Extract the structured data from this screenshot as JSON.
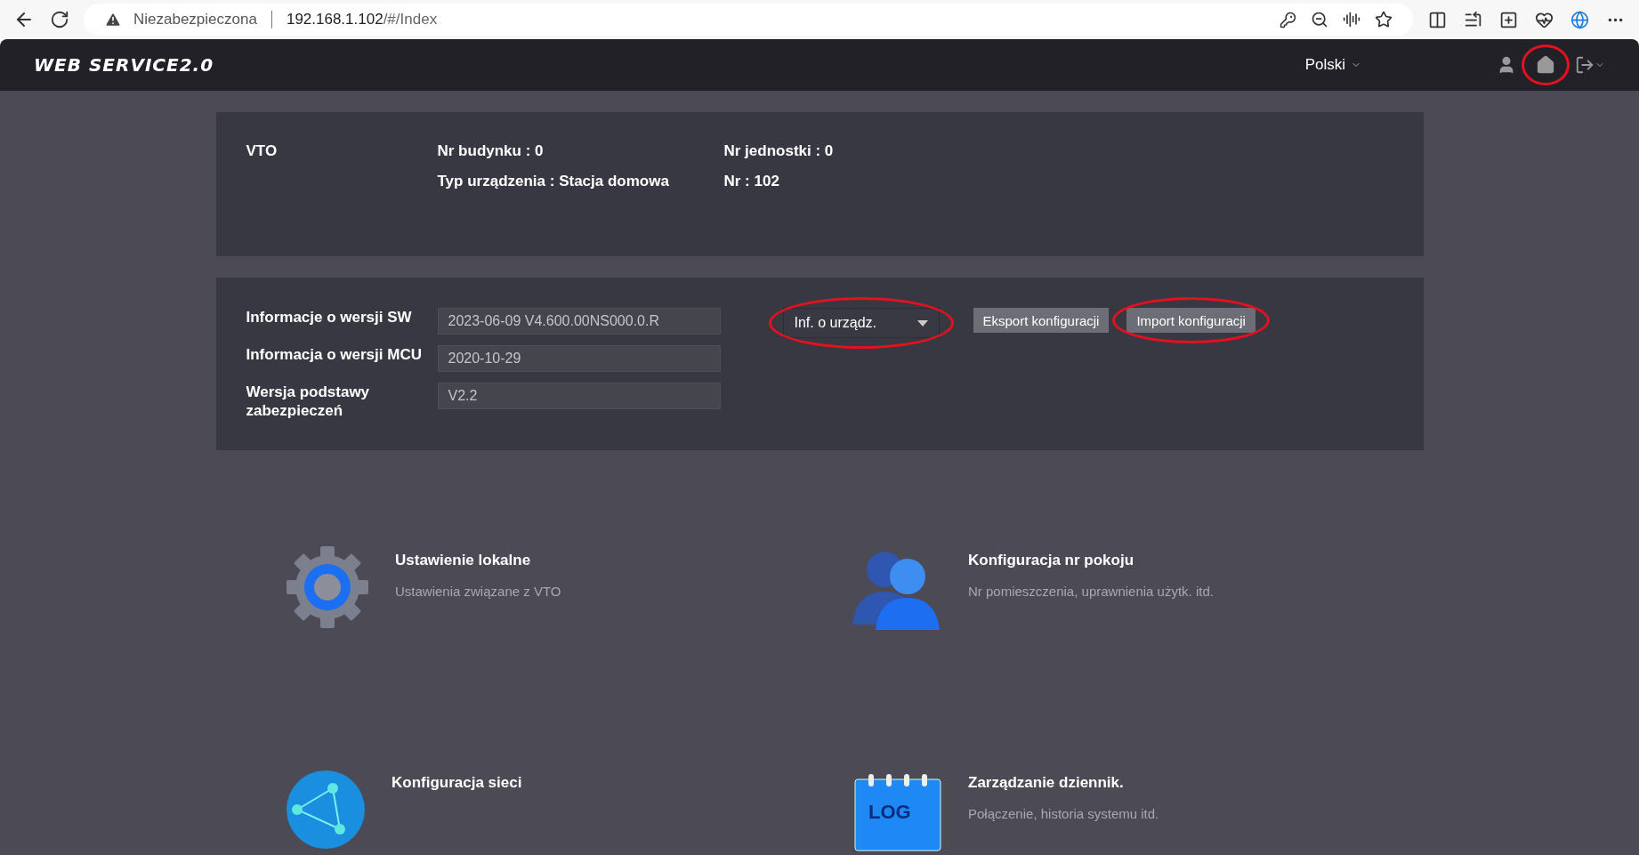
{
  "browser": {
    "security_label": "Niezabezpieczona",
    "url_host": "192.168.1.102",
    "url_path": "/#/Index"
  },
  "header": {
    "logo": "WEB SERVICE2.0",
    "language": "Polski",
    "home_highlighted": true
  },
  "device": {
    "name": "VTO",
    "items": [
      "Nr budynku : 0",
      "Nr jednostki : 0",
      "Typ urządzenia : Stacja domowa",
      "Nr : 102"
    ]
  },
  "versions": [
    {
      "label": "Informacje o wersji SW",
      "value": "2023-06-09 V4.600.00NS000.0.R"
    },
    {
      "label": "Informacja o wersji MCU",
      "value": "2020-10-29"
    },
    {
      "label": "Wersja podstawy zabezpieczeń",
      "value": "V2.2"
    }
  ],
  "device_menu": {
    "value": "Inf. o urządz.",
    "highlighted": true
  },
  "actions": [
    {
      "label": "Eksport konfiguracji",
      "highlighted": false
    },
    {
      "label": "Import konfiguracji",
      "highlighted": true
    }
  ],
  "tiles": [
    {
      "kind": "settings",
      "title": "Ustawienie lokalne",
      "description": "Ustawienia związane z VTO"
    },
    {
      "kind": "users",
      "title": "Konfiguracja nr pokoju",
      "description": "Nr pomieszczenia, uprawnienia użytk. itd."
    },
    {
      "kind": "network",
      "title": "Konfiguracja sieci"
    },
    {
      "kind": "log",
      "title": "Zarządzanie dziennik.",
      "description": "Połączenie, historia systemu itd.",
      "icon_text": "LOG"
    }
  ]
}
